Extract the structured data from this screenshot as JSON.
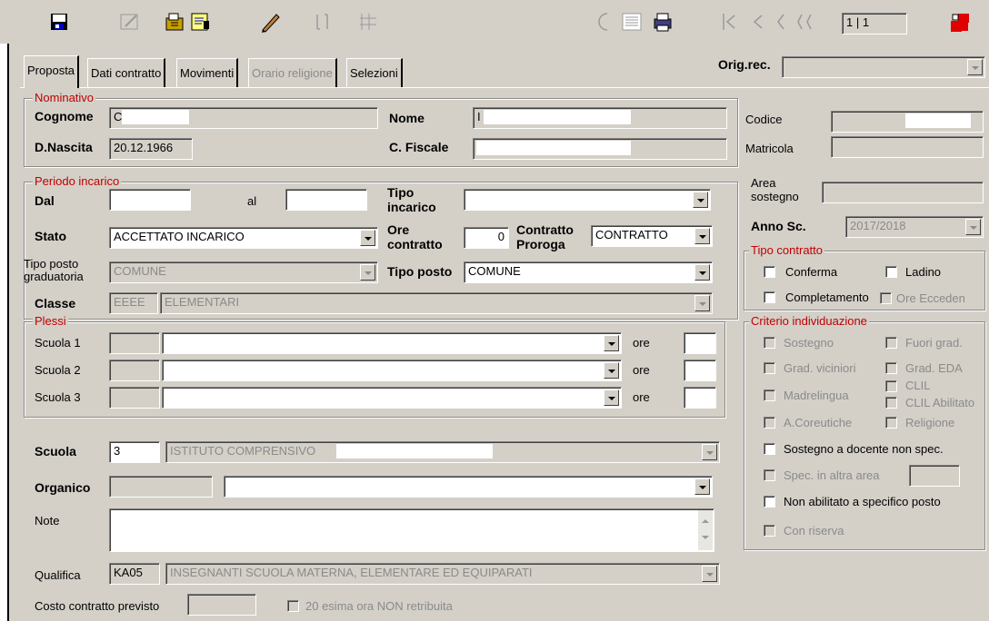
{
  "toolbar": {
    "icons": [
      "save-icon",
      "edit-icon",
      "folder-icon",
      "notes-icon",
      "pencil-icon",
      "bracket-icon",
      "grid-icon",
      "moon-icon",
      "list-icon",
      "print-icon",
      "nav-first-icon",
      "nav-prev-icon",
      "nav-next-icon",
      "nav-last-icon",
      "exit-icon"
    ],
    "record_counter": "1 | 1"
  },
  "tabs": [
    {
      "label": "Proposta"
    },
    {
      "label": "Dati contratto"
    },
    {
      "label": "Movimenti"
    },
    {
      "label": "Orario religione"
    },
    {
      "label": "Selezioni"
    }
  ],
  "orig_rec": {
    "label": "Orig.rec.",
    "value": ""
  },
  "nominativo": {
    "title": "Nominativo",
    "cognome_label": "Cognome",
    "cognome_value": "C",
    "nome_label": "Nome",
    "nome_value": "I",
    "nascita_label": "D.Nascita",
    "nascita_value": "20.12.1966",
    "fiscale_label": "C. Fiscale",
    "fiscale_value": "",
    "codice_label": "Codice",
    "codice_value": "",
    "matricola_label": "Matricola",
    "matricola_value": ""
  },
  "periodo": {
    "title": "Periodo incarico",
    "dal_label": "Dal",
    "dal_value": "",
    "al_label": "al",
    "al_value": "",
    "tipo_incarico_label": "Tipo incarico",
    "tipo_incarico_value": "",
    "stato_label": "Stato",
    "stato_value": "ACCETTATO INCARICO",
    "ore_label": "Ore contratto",
    "ore_value": "0",
    "proroga_label": "Contratto Proroga",
    "proroga_value": "CONTRATTO",
    "tipo_posto_grad_label": "Tipo posto graduatoria",
    "tipo_posto_grad_value": "COMUNE",
    "tipo_posto_label": "Tipo posto",
    "tipo_posto_value": "COMUNE",
    "classe_label": "Classe",
    "classe_code": "EEEE",
    "classe_value": "ELEMENTARI"
  },
  "plessi": {
    "title": "Plessi",
    "rows": [
      {
        "label": "Scuola 1",
        "ore_label": "ore"
      },
      {
        "label": "Scuola 2",
        "ore_label": "ore"
      },
      {
        "label": "Scuola 3",
        "ore_label": "ore"
      }
    ]
  },
  "scuola": {
    "label": "Scuola",
    "code": "3",
    "value": "ISTITUTO COMPRENSIVO"
  },
  "organico": {
    "label": "Organico",
    "code": "",
    "value": ""
  },
  "note": {
    "label": "Note",
    "value": ""
  },
  "qualifica": {
    "label": "Qualifica",
    "code": "KA05",
    "value": "INSEGNANTI SCUOLA MATERNA, ELEMENTARE ED EQUIPARATI"
  },
  "costo": {
    "label": "Costo contratto previsto",
    "value": "",
    "check_label": "20 esima ora NON retribuita"
  },
  "right": {
    "area_label": "Area sostegno",
    "area_value": "",
    "anno_label": "Anno Sc.",
    "anno_value": "2017/2018",
    "tipo_contratto_title": "Tipo contratto",
    "conferma": "Conferma",
    "ladino": "Ladino",
    "completamento": "Completamento",
    "ore_eccedenti": "Ore Ecceden",
    "criterio_title": "Criterio individuazione",
    "sostegno": "Sostegno",
    "fuori_grad": "Fuori grad.",
    "grad_viciniori": "Grad. viciniori",
    "grad_eda": "Grad. EDA",
    "madrelingua": "Madrelingua",
    "clil": "CLIL",
    "clil_abilitato": "CLIL Abilitato",
    "a_coreutiche": "A.Coreutiche",
    "religione": "Religione",
    "sostegno_docente": "Sostegno a docente non spec.",
    "spec_altra_area": "Spec. in altra area",
    "non_abilitato": "Non abilitato a specifico posto",
    "con_riserva": "Con riserva"
  }
}
